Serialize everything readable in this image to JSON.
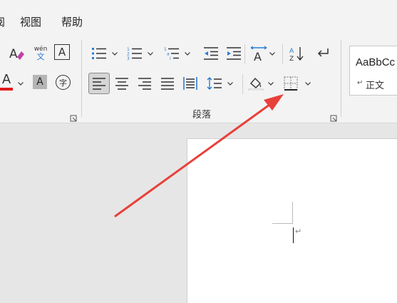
{
  "menu": {
    "items": [
      {
        "label": "阅"
      },
      {
        "label": "视图"
      },
      {
        "label": "帮助"
      }
    ]
  },
  "font_group": {
    "phonetic_top": "wén",
    "phonetic_bottom": "文",
    "char_border_glyph": "A",
    "font_color_glyph": "A",
    "char_shading_glyph": "A",
    "enclose_char_glyph": "字"
  },
  "paragraph_group": {
    "label": "段落"
  },
  "styles": {
    "sample": "AaBbCc",
    "name": "正文"
  },
  "colors": {
    "font_color": "#e01a1a",
    "accent": "#2b7cd3",
    "arrow": "#e8403a"
  }
}
